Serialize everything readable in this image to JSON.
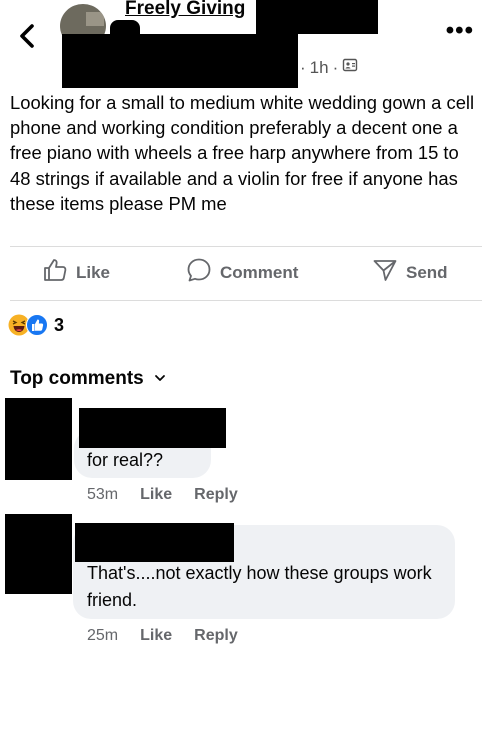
{
  "header": {
    "group_name": "Freely Giving",
    "time": "1h",
    "separator": "·"
  },
  "post": {
    "text": "Looking for a small to medium white wedding gown a cell phone and working condition preferably a decent one a free piano with wheels a free harp anywhere from 15 to 48 strings if available and a violin for free if anyone has these items please PM me"
  },
  "actions": {
    "like": "Like",
    "comment": "Comment",
    "send": "Send"
  },
  "reactions": {
    "count": "3"
  },
  "comments_section": {
    "title": "Top comments"
  },
  "comments": [
    {
      "text": "for real??",
      "time": "53m",
      "like": "Like",
      "reply": "Reply"
    },
    {
      "text": "That's....not exactly how these groups work friend.",
      "time": "25m",
      "like": "Like",
      "reply": "Reply"
    }
  ],
  "colors": {
    "like_blue": "#1877f2",
    "haha_yellow": "#f7b125",
    "muted_text": "#65676b",
    "bubble": "#eff1f4"
  }
}
